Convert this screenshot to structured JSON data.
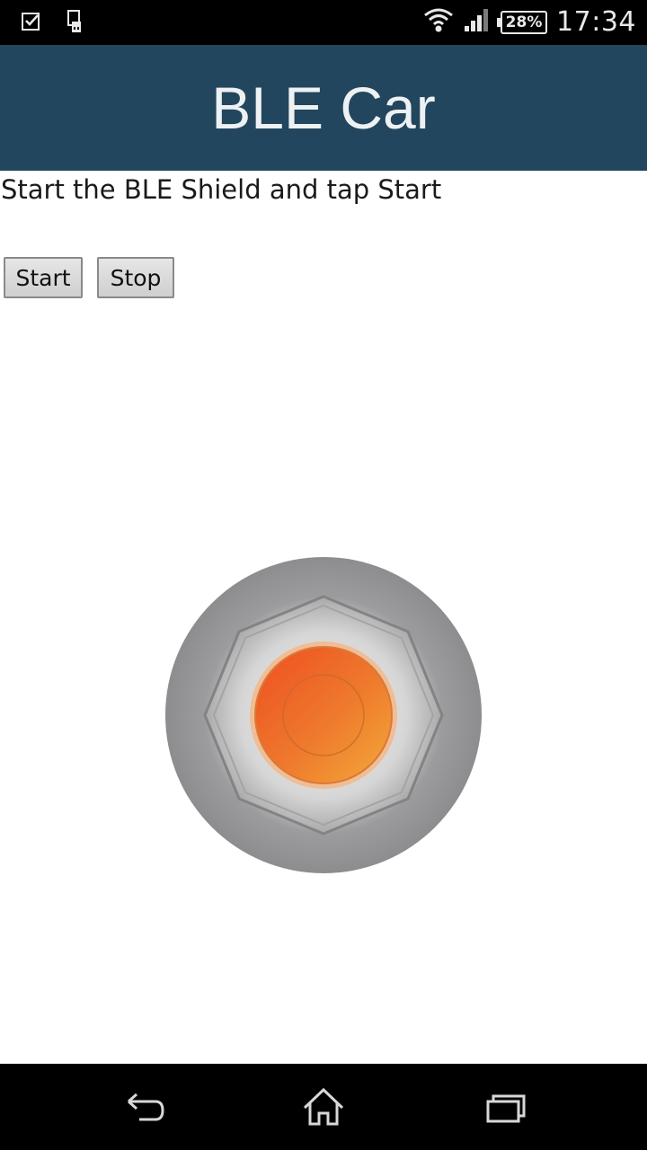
{
  "status_bar": {
    "icons": [
      "checkbox-notification-icon",
      "usb-device-icon",
      "wifi-icon",
      "signal-icon"
    ],
    "battery": "28%",
    "time": "17:34"
  },
  "app": {
    "title": "BLE Car",
    "instruction": "Start the BLE Shield and tap Start",
    "buttons": {
      "start": "Start",
      "stop": "Stop"
    }
  },
  "joystick": {
    "outer_color": "#8f8e90",
    "knob_color": "#ee7a2c"
  },
  "nav_bar": {
    "icons": [
      "back-icon",
      "home-icon",
      "recent-apps-icon"
    ]
  }
}
